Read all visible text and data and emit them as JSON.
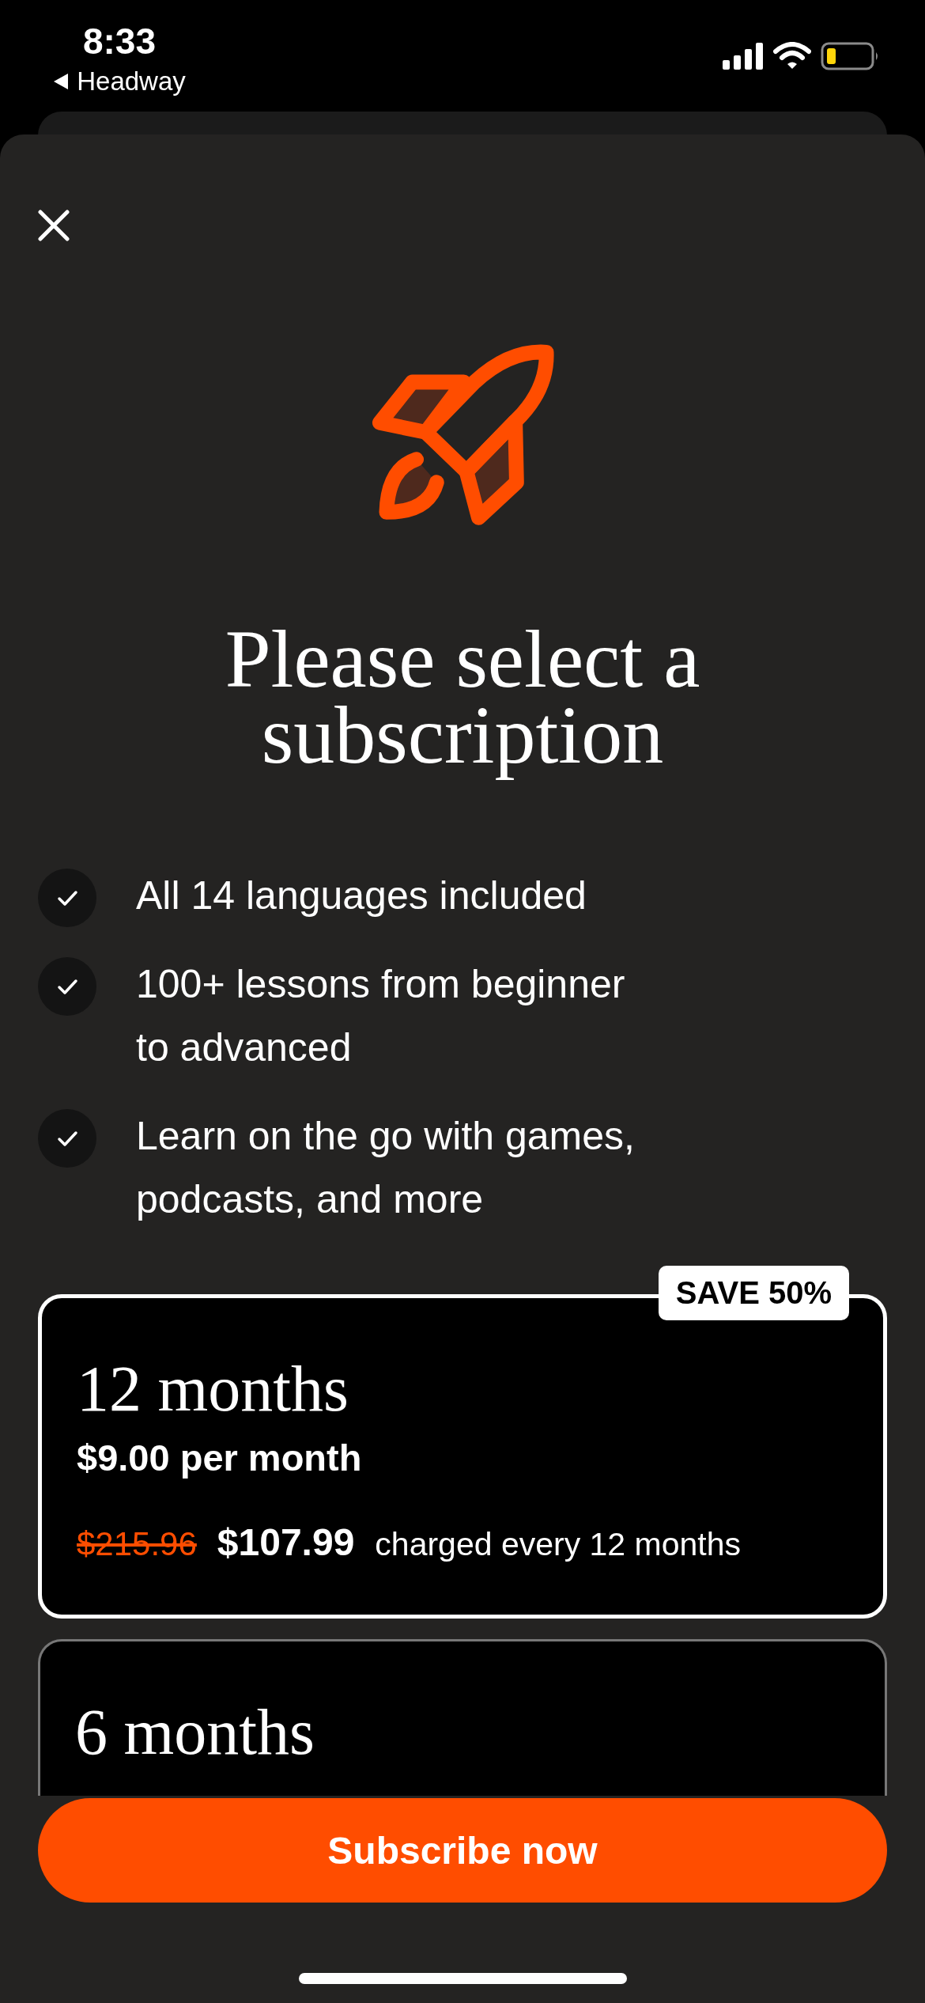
{
  "status_bar": {
    "time": "8:33",
    "back_label": "Headway"
  },
  "title": "Please select a subscription",
  "features": [
    "All 14 languages included",
    "100+ lessons from beginner to advanced",
    "Learn on the go with games, podcasts, and more"
  ],
  "plans": [
    {
      "title": "12 months",
      "selected": true,
      "badge": "SAVE 50%",
      "per_month": "$9.00 per month",
      "old_price": "$215.96",
      "price": "$107.99",
      "billing": "charged every 12 months"
    },
    {
      "title": "6 months",
      "selected": false
    }
  ],
  "button": "Subscribe now"
}
